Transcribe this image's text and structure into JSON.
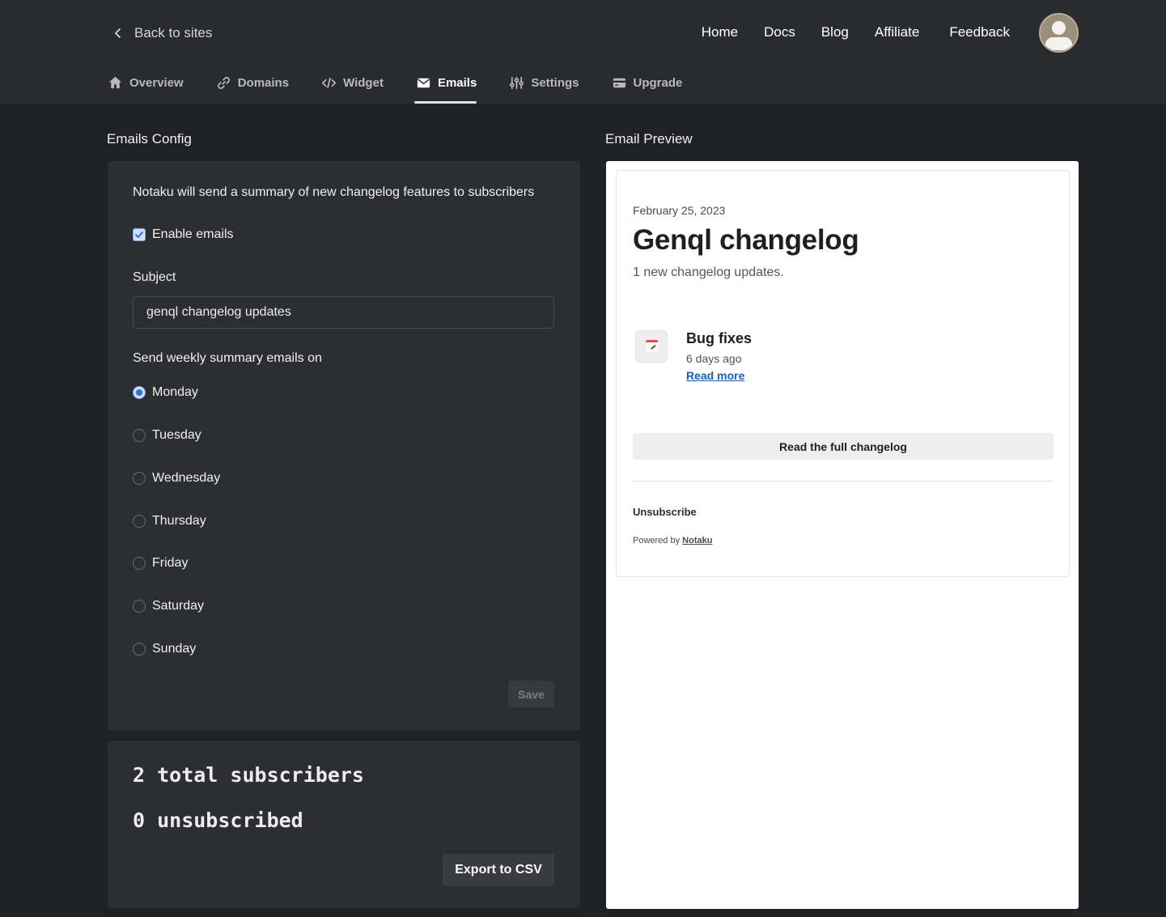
{
  "header": {
    "back_label": "Back to sites",
    "nav": [
      "Home",
      "Docs",
      "Blog",
      "Affiliate",
      "Feedback"
    ],
    "tabs": [
      {
        "label": "Overview",
        "icon": "home-icon"
      },
      {
        "label": "Domains",
        "icon": "link-icon"
      },
      {
        "label": "Widget",
        "icon": "code-icon"
      },
      {
        "label": "Emails",
        "icon": "mail-icon",
        "active": true
      },
      {
        "label": "Settings",
        "icon": "sliders-icon"
      },
      {
        "label": "Upgrade",
        "icon": "credit-card-icon"
      }
    ]
  },
  "config": {
    "title": "Emails Config",
    "intro": "Notaku will send a summary of new changelog features to subscribers",
    "enable_label": "Enable emails",
    "enable_checked": true,
    "subject_label": "Subject",
    "subject_value": "genql changelog updates",
    "schedule_label": "Send weekly summary emails on",
    "days": [
      "Monday",
      "Tuesday",
      "Wednesday",
      "Thursday",
      "Friday",
      "Saturday",
      "Sunday"
    ],
    "selected_day": "Monday",
    "save_label": "Save"
  },
  "stats": {
    "total": "2 total subscribers",
    "unsubscribed": "0 unsubscribed",
    "export_label": "Export to CSV"
  },
  "preview": {
    "title": "Email Preview",
    "date": "February 25, 2023",
    "heading": "Genql changelog",
    "subheading": "1 new changelog updates.",
    "entry": {
      "icon": "calendar-icon",
      "title": "Bug fixes",
      "time": "6 days ago",
      "link": "Read more"
    },
    "full_button": "Read the full changelog",
    "unsubscribe": "Unsubscribe",
    "powered_prefix": "Powered by",
    "powered_link": "Notaku"
  }
}
